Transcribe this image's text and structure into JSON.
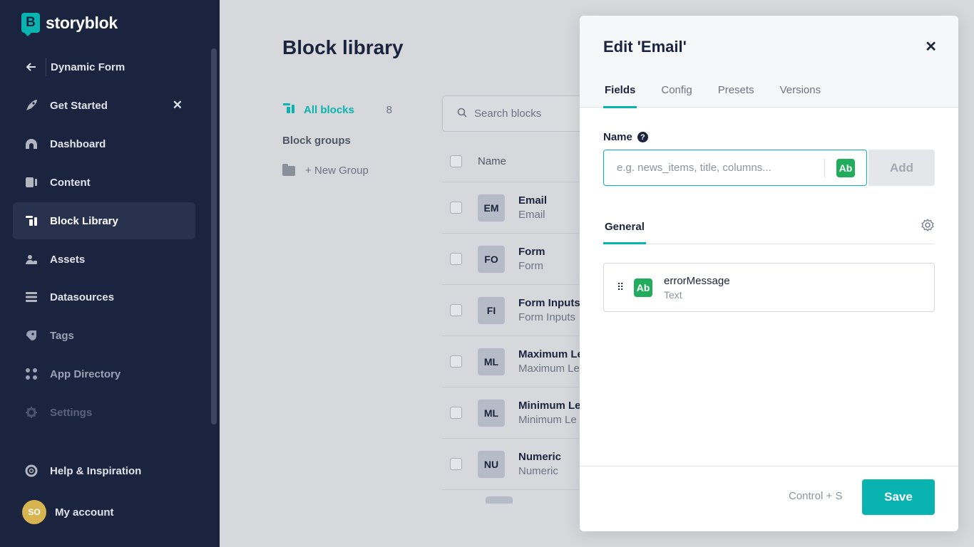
{
  "brand": {
    "name": "storyblok",
    "logo_letter": "B"
  },
  "sidebar": {
    "back_label": "Dynamic Form",
    "items": [
      {
        "label": "Get Started",
        "icon": "rocket-icon"
      },
      {
        "label": "Dashboard",
        "icon": "dashboard-icon"
      },
      {
        "label": "Content",
        "icon": "content-icon"
      },
      {
        "label": "Block Library",
        "icon": "block-library-icon"
      },
      {
        "label": "Assets",
        "icon": "assets-icon"
      },
      {
        "label": "Datasources",
        "icon": "datasources-icon"
      },
      {
        "label": "Tags",
        "icon": "tag-icon"
      },
      {
        "label": "App Directory",
        "icon": "apps-icon"
      },
      {
        "label": "Settings",
        "icon": "gear-icon"
      }
    ],
    "help_label": "Help & Inspiration",
    "account_label": "My account",
    "avatar_initials": "SO",
    "active_item": "Block Library"
  },
  "main": {
    "title": "Block library",
    "all_blocks_label": "All blocks",
    "all_blocks_count": "8",
    "block_groups_label": "Block groups",
    "new_group_label": "+ New Group",
    "search_placeholder": "Search blocks",
    "name_column": "Name",
    "rows": [
      {
        "badge": "EM",
        "title": "Email",
        "subtitle": "Email"
      },
      {
        "badge": "FO",
        "title": "Form",
        "subtitle": "Form"
      },
      {
        "badge": "FI",
        "title": "Form Inputs",
        "subtitle": "Form Inputs"
      },
      {
        "badge": "ML",
        "title": "Maximum Le",
        "subtitle": "Maximum Le"
      },
      {
        "badge": "ML",
        "title": "Minimum Le",
        "subtitle": "Minimum Le"
      },
      {
        "badge": "NU",
        "title": "Numeric",
        "subtitle": "Numeric"
      }
    ]
  },
  "modal": {
    "title": "Edit 'Email'",
    "tabs": [
      "Fields",
      "Config",
      "Presets",
      "Versions"
    ],
    "active_tab": "Fields",
    "name_label": "Name",
    "name_placeholder": "e.g. news_items, title, columns...",
    "type_badge": "Ab",
    "add_label": "Add",
    "section_tab": "General",
    "field": {
      "name": "errorMessage",
      "type": "Text",
      "badge": "Ab"
    },
    "shortcut": "Control + S",
    "save_label": "Save"
  },
  "colors": {
    "accent": "#09b3af",
    "sidebar_bg": "#1b243f",
    "text_badge": "#22ad5c"
  }
}
